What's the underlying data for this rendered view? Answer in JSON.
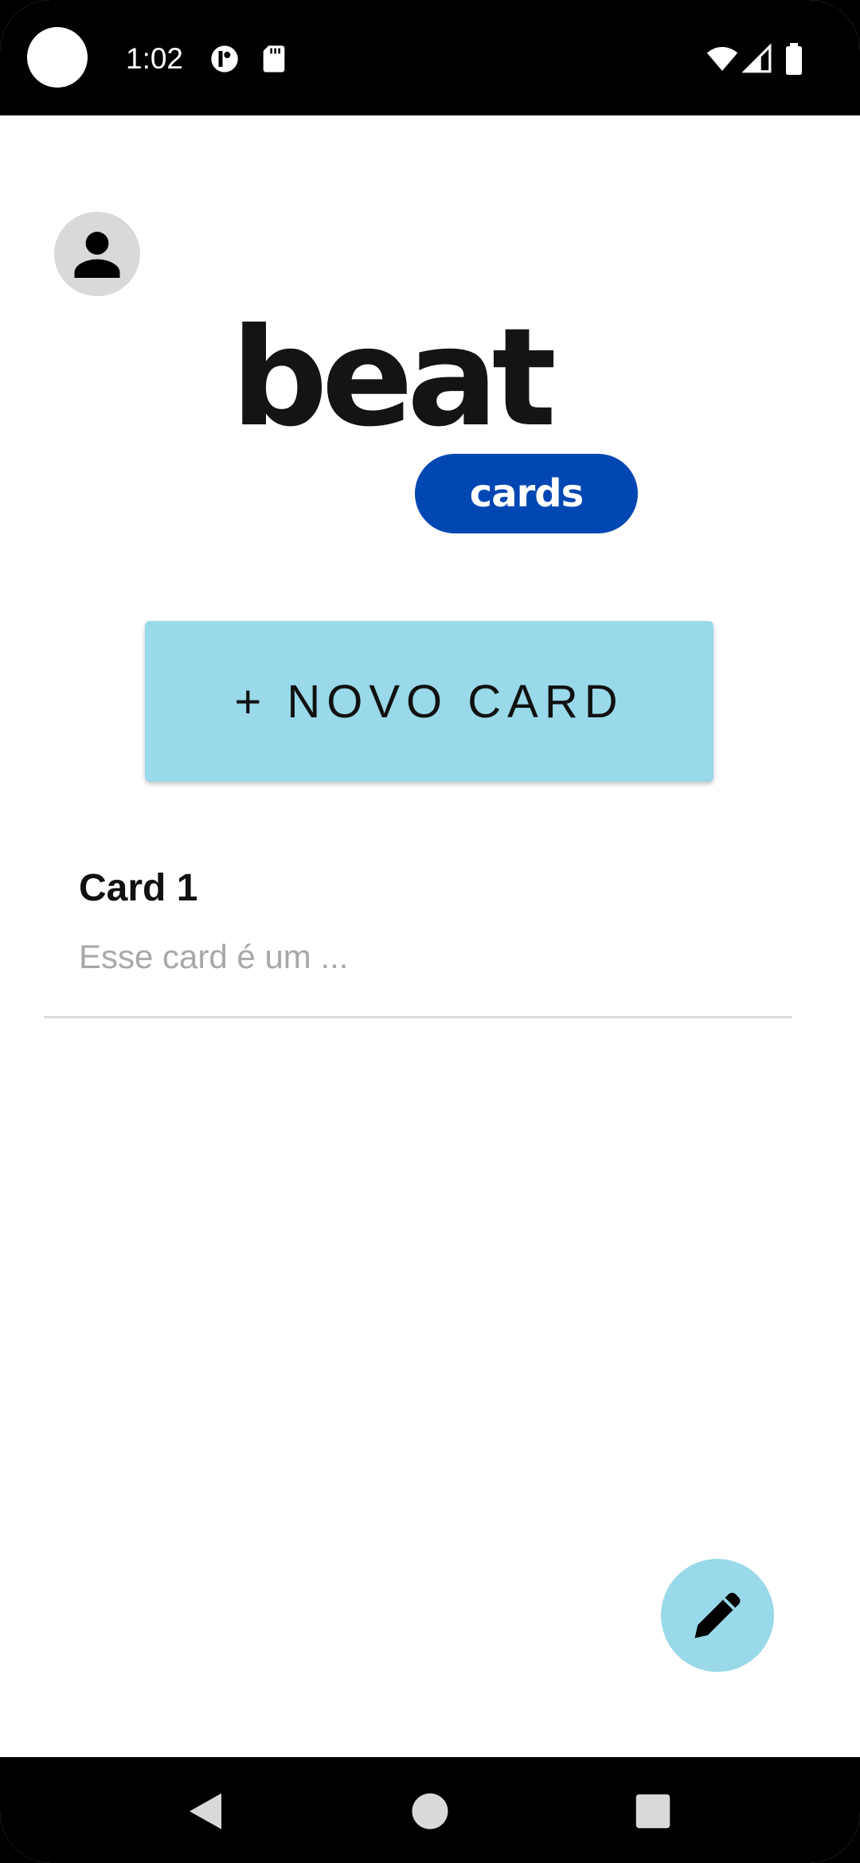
{
  "status_bar": {
    "time": "1:02",
    "icons": [
      "camera-cutout",
      "data-saver-icon",
      "sd-card-icon",
      "wifi-icon",
      "cell-signal-icon",
      "battery-icon"
    ]
  },
  "header": {
    "avatar_icon": "person-icon"
  },
  "logo": {
    "word": "beat",
    "badge": "cards",
    "badge_color": "#0047b3"
  },
  "actions": {
    "new_card_label": "+ NOVO CARD",
    "new_card_color": "#99d9e9"
  },
  "cards": [
    {
      "title": "Card 1",
      "description": "Esse card é um ..."
    }
  ],
  "fab": {
    "icon": "pencil-icon",
    "color": "#99d9e9"
  },
  "nav_bar": {
    "icons": [
      "back-icon",
      "home-icon",
      "recents-icon"
    ]
  }
}
